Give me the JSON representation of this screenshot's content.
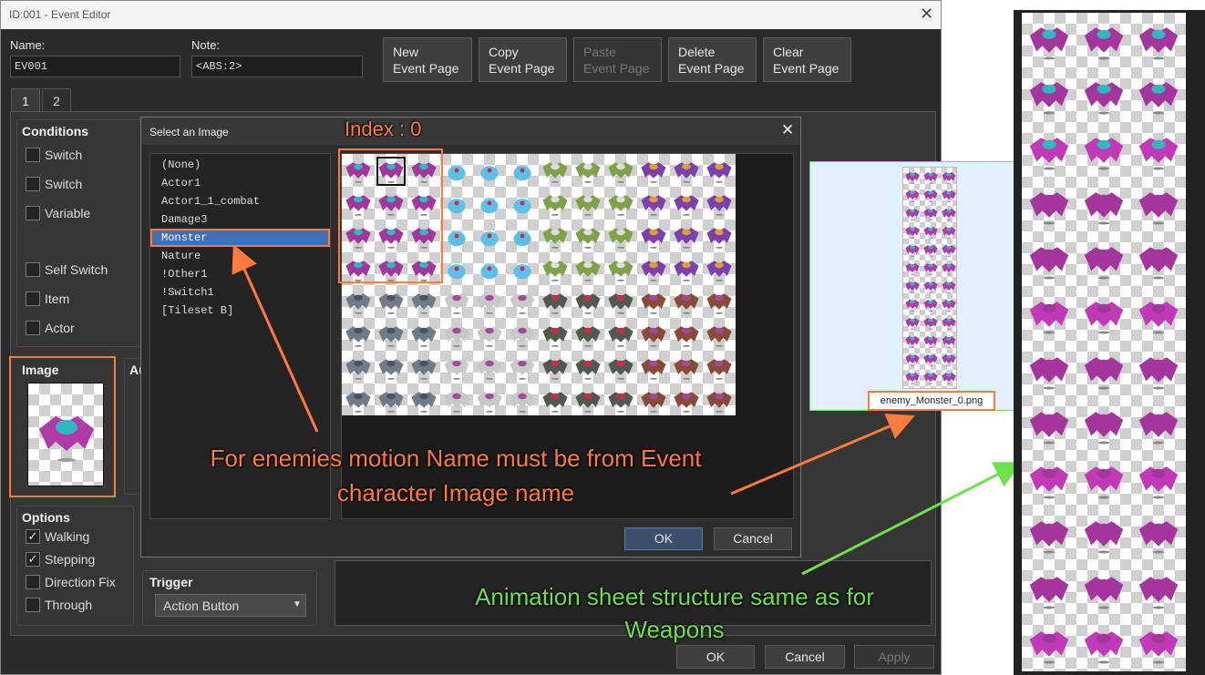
{
  "editor": {
    "title": "ID:001 - Event Editor",
    "name_label": "Name:",
    "name_value": "EV001",
    "note_label": "Note:",
    "note_value": "<ABS:2>",
    "page_buttons": [
      {
        "line1": "New",
        "line2": "Event Page"
      },
      {
        "line1": "Copy",
        "line2": "Event Page"
      },
      {
        "line1": "Paste",
        "line2": "Event Page"
      },
      {
        "line1": "Delete",
        "line2": "Event Page"
      },
      {
        "line1": "Clear",
        "line2": "Event Page"
      }
    ],
    "tabs": [
      "1",
      "2"
    ],
    "conditions_header": "Conditions",
    "conditions": [
      "Switch",
      "Switch",
      "Variable",
      "Self Switch",
      "Item",
      "Actor"
    ],
    "image_header": "Image",
    "autonomous_partial": "Au",
    "options_header": "Options",
    "options": [
      {
        "label": "Walking",
        "checked": true
      },
      {
        "label": "Stepping",
        "checked": true
      },
      {
        "label": "Direction Fix",
        "checked": false
      },
      {
        "label": "Through",
        "checked": false
      }
    ],
    "trigger_header": "Trigger",
    "trigger_value": "Action Button",
    "footer_buttons": {
      "ok": "OK",
      "cancel": "Cancel",
      "apply": "Apply"
    }
  },
  "dialog": {
    "title": "Select an Image",
    "files": [
      "(None)",
      "Actor1",
      "Actor1_1_combat",
      "Damage3",
      "Monster",
      "Nature",
      "!Other1",
      "!Switch1",
      "[Tileset B]"
    ],
    "selected_index": 4,
    "ok": "OK",
    "cancel": "Cancel"
  },
  "annotations": {
    "index_label": "Index : 0",
    "motion_note": "For enemies motion Name must be from Event character Image name",
    "file_caption": "enemy_Monster_0.png",
    "sheet_note": "Animation sheet structure same as for Weapons"
  },
  "colors": {
    "accent_orange": "#ff7a3d",
    "accent_green": "#6de04a",
    "selection_blue": "#3f6fb4"
  }
}
